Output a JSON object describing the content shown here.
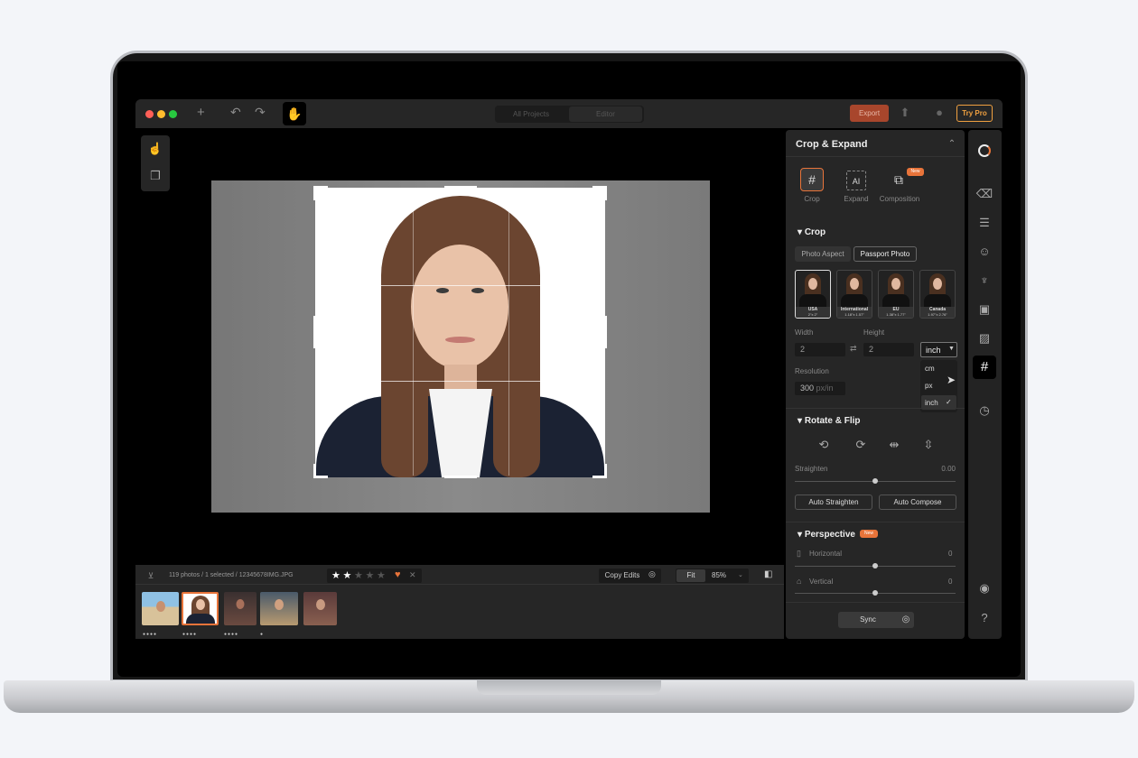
{
  "toolbar": {
    "tab_all_projects": "All Projects",
    "tab_editor": "Editor",
    "export": "Export",
    "try_pro": "Try Pro"
  },
  "panel": {
    "title": "Crop & Expand",
    "modes": [
      {
        "label": "Crop",
        "icon": "crop-icon"
      },
      {
        "label": "Expand",
        "icon": "ai-expand-icon"
      },
      {
        "label": "Composition",
        "icon": "composition-icon",
        "badge": "New"
      }
    ],
    "crop_section": "Crop",
    "aspect_tabs": [
      "Photo Aspect",
      "Passport Photo"
    ],
    "presets": [
      {
        "name": "USA",
        "size": "2\"x 2\""
      },
      {
        "name": "International",
        "size": "1.18\"x 1.57\""
      },
      {
        "name": "EU",
        "size": "1.38\"x 1.77\""
      },
      {
        "name": "Canada",
        "size": "1.97\"x 2.76\""
      }
    ],
    "width_label": "Width",
    "height_label": "Height",
    "width_value": "2",
    "height_value": "2",
    "unit_value": "inch",
    "unit_options": [
      "cm",
      "px",
      "inch"
    ],
    "resolution_label": "Resolution",
    "resolution_value": "300",
    "resolution_unit": "px/in",
    "rotate_section": "Rotate & Flip",
    "straighten_label": "Straighten",
    "straighten_value": "0.00",
    "auto_straighten": "Auto Straighten",
    "auto_compose": "Auto Compose",
    "perspective_section": "Perspective",
    "perspective_badge": "New",
    "horizontal_label": "Horizontal",
    "horizontal_value": "0",
    "vertical_label": "Vertical",
    "vertical_value": "0",
    "sync": "Sync"
  },
  "filmstrip": {
    "info": "119 photos / 1 selected / 12345678IMG.JPG",
    "rating": 2,
    "copy_edits": "Copy Edits",
    "fit": "Fit",
    "zoom": "85%"
  },
  "colors": {
    "accent": "#e8743a",
    "export_bg": "#a8462c",
    "pro": "#f0a040"
  }
}
